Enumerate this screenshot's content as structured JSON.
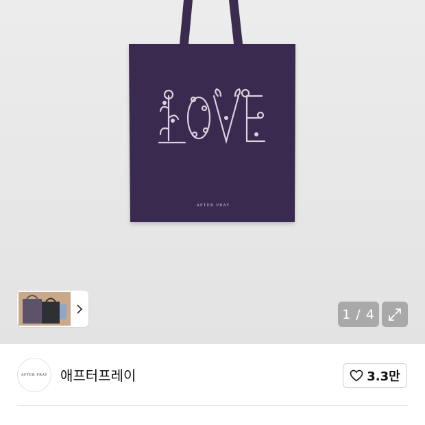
{
  "gallery": {
    "current_page": "1 / 4",
    "bag_brand": "AFTER PRAY",
    "bag_print": "LOVE",
    "bag_color": "#3b2c4f",
    "print_color": "#d8d3df"
  },
  "shop": {
    "logo_text": "AFTER PRAY",
    "name": "애프터프레이",
    "like_count": "3.3만"
  },
  "icons": [
    "chevron-right-icon",
    "expand-icon",
    "heart-icon"
  ]
}
